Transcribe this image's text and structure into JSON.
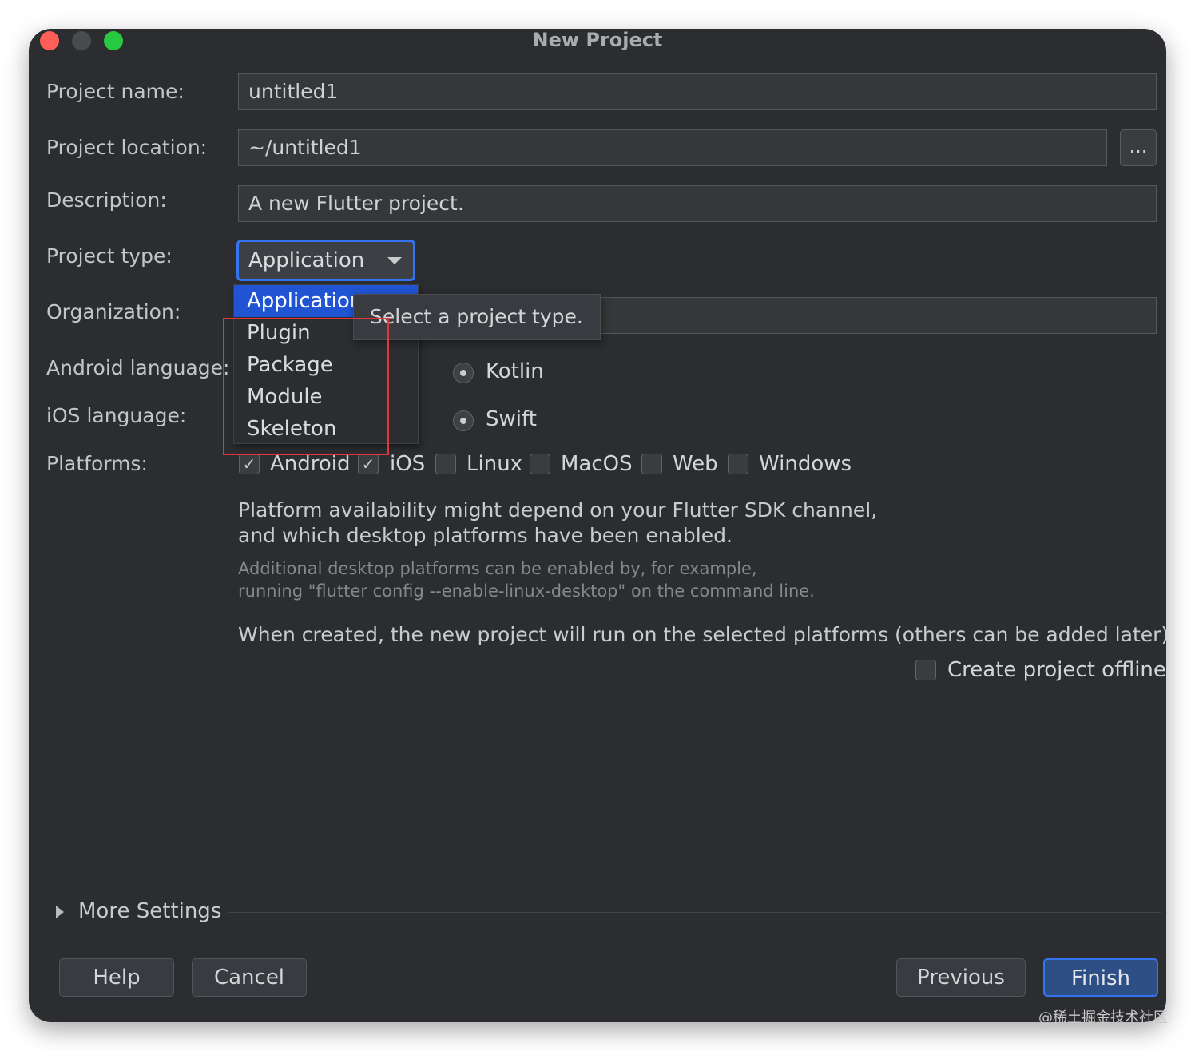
{
  "window": {
    "title": "New Project"
  },
  "form": {
    "project_name": {
      "label": "Project name:",
      "value": "untitled1"
    },
    "project_location": {
      "label": "Project location:",
      "value": "~/untitled1",
      "browse_label": "..."
    },
    "description": {
      "label": "Description:",
      "value": "A new Flutter project."
    },
    "project_type": {
      "label": "Project type:",
      "selected": "Application",
      "options": [
        "Application",
        "Plugin",
        "Package",
        "Module",
        "Skeleton"
      ],
      "tooltip": "Select a project type."
    },
    "organization": {
      "label": "Organization:"
    },
    "android_language": {
      "label": "Android language:",
      "selected": "Kotlin"
    },
    "ios_language": {
      "label": "iOS language:",
      "selected": "Swift"
    },
    "platforms": {
      "label": "Platforms:",
      "items": [
        {
          "name": "Android",
          "checked": true
        },
        {
          "name": "iOS",
          "checked": true
        },
        {
          "name": "Linux",
          "checked": false
        },
        {
          "name": "MacOS",
          "checked": false
        },
        {
          "name": "Web",
          "checked": false
        },
        {
          "name": "Windows",
          "checked": false
        }
      ]
    },
    "info_line1": "Platform availability might depend on your Flutter SDK channel,",
    "info_line2": "and which desktop platforms have been enabled.",
    "hint_line1": "Additional desktop platforms can be enabled by, for example,",
    "hint_line2": "running \"flutter config --enable-linux-desktop\" on the command line.",
    "created_note": "When created, the new project will run on the selected platforms (others can be added later).",
    "offline": {
      "label": "Create project offline",
      "checked": false
    }
  },
  "more_settings": {
    "label": "More Settings"
  },
  "buttons": {
    "help": "Help",
    "cancel": "Cancel",
    "previous": "Previous",
    "finish": "Finish"
  },
  "watermark": "@稀土掘金技术社区",
  "colors": {
    "accent": "#3574f0",
    "selection": "#2154d3",
    "highlight_box": "#e2363a",
    "background": "#2b2d30"
  }
}
